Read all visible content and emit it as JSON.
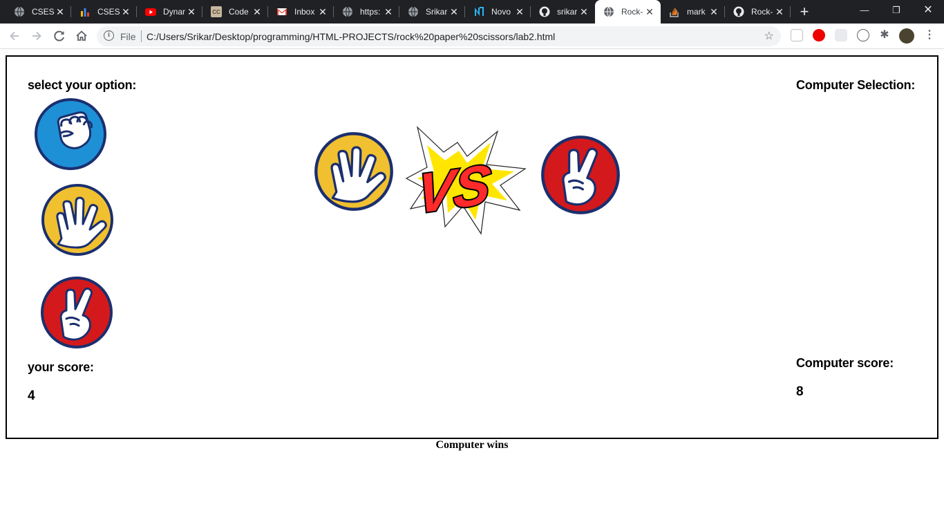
{
  "browser": {
    "tabs": [
      {
        "title": "CSES",
        "icon": "globe-icon"
      },
      {
        "title": "CSES",
        "icon": "bar-chart-icon"
      },
      {
        "title": "Dynar",
        "icon": "youtube-icon"
      },
      {
        "title": "Code",
        "icon": "codechef-icon"
      },
      {
        "title": "Inbox",
        "icon": "gmail-icon"
      },
      {
        "title": "https:",
        "icon": "globe-icon"
      },
      {
        "title": "Srikar",
        "icon": "globe-icon"
      },
      {
        "title": "Novo",
        "icon": "novo-icon"
      },
      {
        "title": "srikar",
        "icon": "github-icon"
      },
      {
        "title": "Rock-",
        "icon": "globe-icon",
        "active": true
      },
      {
        "title": "mark",
        "icon": "stackoverflow-icon"
      },
      {
        "title": "Rock-",
        "icon": "github-icon"
      }
    ],
    "address": {
      "scheme_label": "File",
      "url": "C:/Users/Srikar/Desktop/programming/HTML-PROJECTS/rock%20paper%20scissors/lab2.html"
    }
  },
  "game": {
    "select_label": "select your option:",
    "computer_selection_label": "Computer Selection:",
    "your_score_label": "your score:",
    "your_score": "4",
    "computer_score_label": "Computer score:",
    "computer_score": "8",
    "vs_text": "VS",
    "options": [
      {
        "name": "rock",
        "color": "#1e90d6"
      },
      {
        "name": "paper",
        "color": "#f0c030"
      },
      {
        "name": "scissors",
        "color": "#d4191c"
      }
    ],
    "player_choice": "paper",
    "computer_choice": "scissors"
  },
  "result_text": "Computer wins",
  "colors": {
    "rock": "#1e90d6",
    "paper": "#f0c030",
    "scissors": "#d4191c",
    "vs_fill": "#ff2a2a",
    "burst": "#ffe600"
  }
}
